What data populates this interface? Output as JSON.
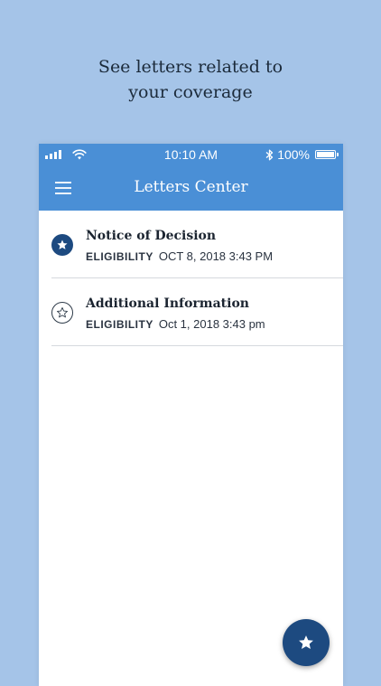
{
  "promo": {
    "line1": "See letters related to",
    "line2": "your coverage"
  },
  "statusbar": {
    "time": "10:10 AM",
    "battery": "100%"
  },
  "appbar": {
    "title": "Letters Center"
  },
  "letters": [
    {
      "title": "Notice of Decision",
      "category": "ELIGIBILITY",
      "date": "OCT 8, 2018 3:43 PM",
      "starred": true
    },
    {
      "title": "Additional Information",
      "category": "ELIGIBILITY",
      "date": "Oct 1, 2018 3:43 pm",
      "starred": false
    }
  ],
  "icons": {
    "menu": "hamburger-menu-icon",
    "fab": "star-icon"
  },
  "colors": {
    "background": "#a5c4e8",
    "primary": "#4a8fd6",
    "accent": "#1d4a80"
  }
}
